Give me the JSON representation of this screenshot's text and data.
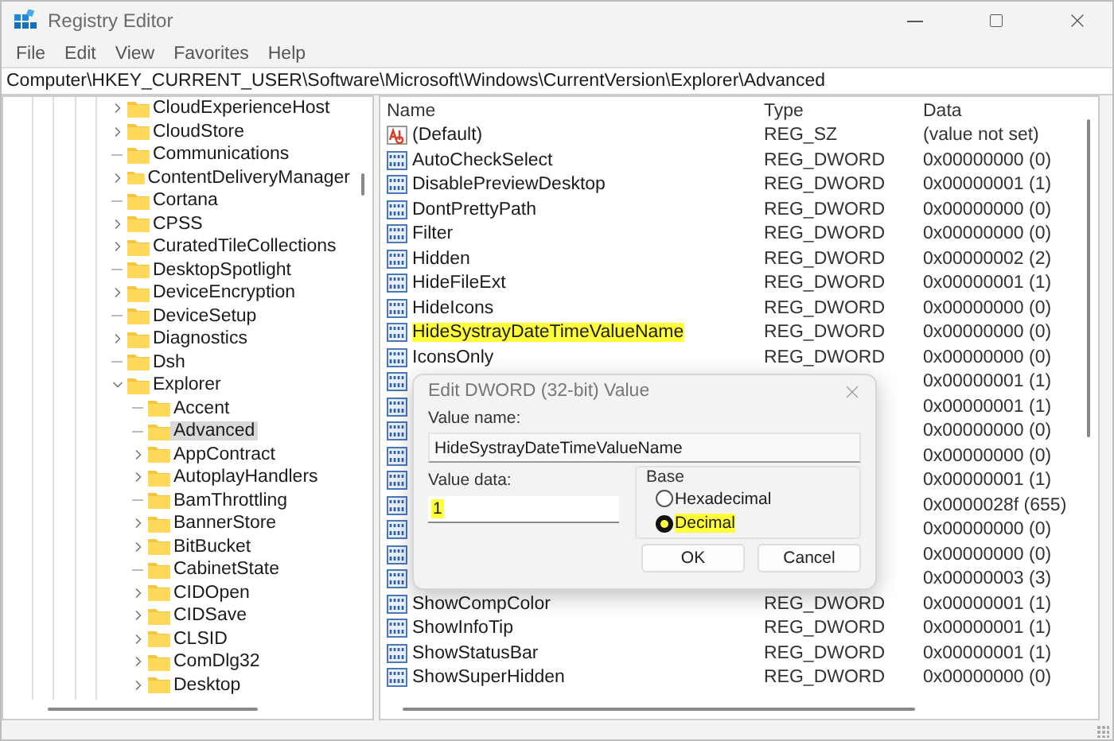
{
  "window": {
    "title": "Registry Editor"
  },
  "menu": [
    "File",
    "Edit",
    "View",
    "Favorites",
    "Help"
  ],
  "address": "Computer\\HKEY_CURRENT_USER\\Software\\Microsoft\\Windows\\CurrentVersion\\Explorer\\Advanced",
  "tree": [
    {
      "label": "CloudExperienceHost",
      "expandable": true,
      "expanded": false,
      "selected": false
    },
    {
      "label": "CloudStore",
      "expandable": true,
      "expanded": false,
      "selected": false
    },
    {
      "label": "Communications",
      "expandable": false,
      "selected": false
    },
    {
      "label": "ContentDeliveryManager",
      "expandable": true,
      "expanded": false,
      "selected": false
    },
    {
      "label": "Cortana",
      "expandable": false,
      "selected": false
    },
    {
      "label": "CPSS",
      "expandable": true,
      "expanded": false,
      "selected": false
    },
    {
      "label": "CuratedTileCollections",
      "expandable": true,
      "expanded": false,
      "selected": false
    },
    {
      "label": "DesktopSpotlight",
      "expandable": false,
      "selected": false
    },
    {
      "label": "DeviceEncryption",
      "expandable": true,
      "expanded": false,
      "selected": false
    },
    {
      "label": "DeviceSetup",
      "expandable": false,
      "selected": false
    },
    {
      "label": "Diagnostics",
      "expandable": true,
      "expanded": false,
      "selected": false
    },
    {
      "label": "Dsh",
      "expandable": false,
      "selected": false
    },
    {
      "label": "Explorer",
      "expandable": true,
      "expanded": true,
      "selected": false,
      "children": [
        {
          "label": "Accent",
          "expandable": false,
          "selected": false
        },
        {
          "label": "Advanced",
          "expandable": false,
          "selected": true
        },
        {
          "label": "AppContract",
          "expandable": true,
          "expanded": false,
          "selected": false
        },
        {
          "label": "AutoplayHandlers",
          "expandable": true,
          "expanded": false,
          "selected": false
        },
        {
          "label": "BamThrottling",
          "expandable": false,
          "selected": false
        },
        {
          "label": "BannerStore",
          "expandable": true,
          "expanded": false,
          "selected": false
        },
        {
          "label": "BitBucket",
          "expandable": true,
          "expanded": false,
          "selected": false
        },
        {
          "label": "CabinetState",
          "expandable": false,
          "selected": false
        },
        {
          "label": "CIDOpen",
          "expandable": true,
          "expanded": false,
          "selected": false
        },
        {
          "label": "CIDSave",
          "expandable": true,
          "expanded": false,
          "selected": false
        },
        {
          "label": "CLSID",
          "expandable": true,
          "expanded": false,
          "selected": false
        },
        {
          "label": "ComDlg32",
          "expandable": true,
          "expanded": false,
          "selected": false
        },
        {
          "label": "Desktop",
          "expandable": true,
          "expanded": false,
          "selected": false
        }
      ]
    }
  ],
  "table": {
    "columns": [
      "Name",
      "Type",
      "Data"
    ],
    "rows": [
      {
        "kind": "string",
        "name": "(Default)",
        "type": "REG_SZ",
        "data": "(value not set)",
        "highlighted": false
      },
      {
        "kind": "dword",
        "name": "AutoCheckSelect",
        "type": "REG_DWORD",
        "data": "0x00000000 (0)",
        "highlighted": false
      },
      {
        "kind": "dword",
        "name": "DisablePreviewDesktop",
        "type": "REG_DWORD",
        "data": "0x00000001 (1)",
        "highlighted": false
      },
      {
        "kind": "dword",
        "name": "DontPrettyPath",
        "type": "REG_DWORD",
        "data": "0x00000000 (0)",
        "highlighted": false
      },
      {
        "kind": "dword",
        "name": "Filter",
        "type": "REG_DWORD",
        "data": "0x00000000 (0)",
        "highlighted": false
      },
      {
        "kind": "dword",
        "name": "Hidden",
        "type": "REG_DWORD",
        "data": "0x00000002 (2)",
        "highlighted": false
      },
      {
        "kind": "dword",
        "name": "HideFileExt",
        "type": "REG_DWORD",
        "data": "0x00000001 (1)",
        "highlighted": false
      },
      {
        "kind": "dword",
        "name": "HideIcons",
        "type": "REG_DWORD",
        "data": "0x00000000 (0)",
        "highlighted": false
      },
      {
        "kind": "dword",
        "name": "HideSystrayDateTimeValueName",
        "type": "REG_DWORD",
        "data": "0x00000000 (0)",
        "highlighted": true
      },
      {
        "kind": "dword",
        "name": "IconsOnly",
        "type": "REG_DWORD",
        "data": "0x00000000 (0)",
        "highlighted": false
      },
      {
        "kind": "dword",
        "data": "0x00000001 (1)"
      },
      {
        "kind": "dword",
        "data": "0x00000001 (1)"
      },
      {
        "kind": "dword",
        "data": "0x00000000 (0)"
      },
      {
        "kind": "dword",
        "data": "0x00000000 (0)"
      },
      {
        "kind": "dword",
        "data": "0x00000001 (1)"
      },
      {
        "kind": "dword",
        "data": "0x0000028f (655)"
      },
      {
        "kind": "dword",
        "data": "0x00000000 (0)"
      },
      {
        "kind": "dword",
        "data": "0x00000000 (0)"
      },
      {
        "kind": "dword",
        "data": "0x00000003 (3)"
      },
      {
        "kind": "dword",
        "name": "ShowCompColor",
        "type": "REG_DWORD",
        "data": "0x00000001 (1)",
        "highlighted": false
      },
      {
        "kind": "dword",
        "name": "ShowInfoTip",
        "type": "REG_DWORD",
        "data": "0x00000001 (1)",
        "highlighted": false
      },
      {
        "kind": "dword",
        "name": "ShowStatusBar",
        "type": "REG_DWORD",
        "data": "0x00000001 (1)",
        "highlighted": false
      },
      {
        "kind": "dword",
        "name": "ShowSuperHidden",
        "type": "REG_DWORD",
        "data": "0x00000000 (0)",
        "highlighted": false
      }
    ]
  },
  "dialog": {
    "title": "Edit DWORD (32-bit) Value",
    "value_name_label": "Value name:",
    "value_name": "HideSystrayDateTimeValueName",
    "value_data_label": "Value data:",
    "value_data": "1",
    "value_data_highlighted": true,
    "base_label": "Base",
    "base_options": [
      {
        "label": "Hexadecimal",
        "selected": false,
        "highlighted": false
      },
      {
        "label": "Decimal",
        "selected": true,
        "highlighted": true
      }
    ],
    "buttons": [
      "OK",
      "Cancel"
    ]
  }
}
